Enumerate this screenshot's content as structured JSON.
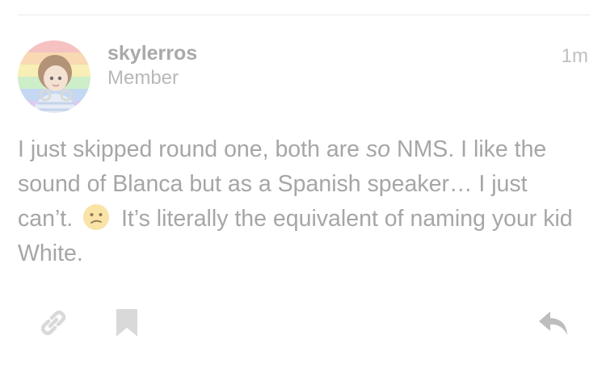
{
  "post": {
    "author": {
      "username": "skylerros",
      "role": "Member",
      "avatar_icon": "rainbow-avatar-illustration"
    },
    "timestamp": "1m",
    "body": {
      "part1": "I just skipped round one, both are ",
      "emphasis": "so",
      "part2": " NMS. I like the sound of Blanca but as a Spanish speaker… I just can’t.",
      "emoji_icon": "confused-face-emoji",
      "part3": " It’s literally the equivalent of naming your kid White."
    }
  },
  "actions": {
    "link_icon": "link-icon",
    "bookmark_icon": "bookmark-icon",
    "reply_icon": "reply-icon"
  },
  "colors": {
    "text": "#a6a6a6",
    "icon": "#d9d9d9",
    "divider": "#ececec"
  }
}
